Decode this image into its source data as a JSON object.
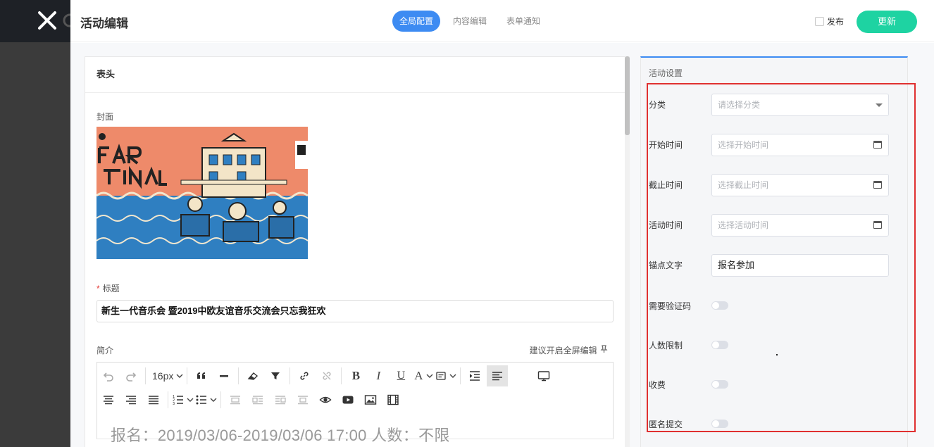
{
  "header": {
    "title": "活动编辑",
    "tabs": [
      {
        "label": "全局配置",
        "active": true
      },
      {
        "label": "内容编辑",
        "active": false
      },
      {
        "label": "表单通知",
        "active": false
      }
    ],
    "publish_label": "发布",
    "publish_checked": false,
    "update_label": "更新"
  },
  "editor": {
    "section_title": "表头",
    "cover_label": "封面",
    "title_label": "标题",
    "title_value": "新生一代音乐会  暨2019中欧友谊音乐交流会只忘我狂欢",
    "intro_label": "简介",
    "fullscreen_hint": "建议开启全屏编辑",
    "font_size": "16px",
    "preview_text": "报名：2019/03/06-2019/03/06  17:00        人数：不限"
  },
  "settings": {
    "title": "活动设置",
    "category": {
      "label": "分类",
      "placeholder": "请选择分类"
    },
    "start_time": {
      "label": "开始时间",
      "placeholder": "选择开始时间"
    },
    "end_time": {
      "label": "截止时间",
      "placeholder": "选择截止时间"
    },
    "event_time": {
      "label": "活动时间",
      "placeholder": "选择活动时间"
    },
    "anchor_text": {
      "label": "锚点文字",
      "value": "报名参加"
    },
    "toggles": [
      {
        "label": "需要验证码",
        "on": false
      },
      {
        "label": "人数限制",
        "on": false
      },
      {
        "label": "收费",
        "on": false
      },
      {
        "label": "匿名提交",
        "on": false
      }
    ]
  },
  "colors": {
    "accent_blue": "#3d8bf2",
    "update_green": "#1ed3a2",
    "highlight_red": "#e03030",
    "dark_sidebar": "#1e2126"
  },
  "icons": {
    "close": "close-icon",
    "calendar": "calendar-icon",
    "dropdown": "chevron-down-icon"
  }
}
